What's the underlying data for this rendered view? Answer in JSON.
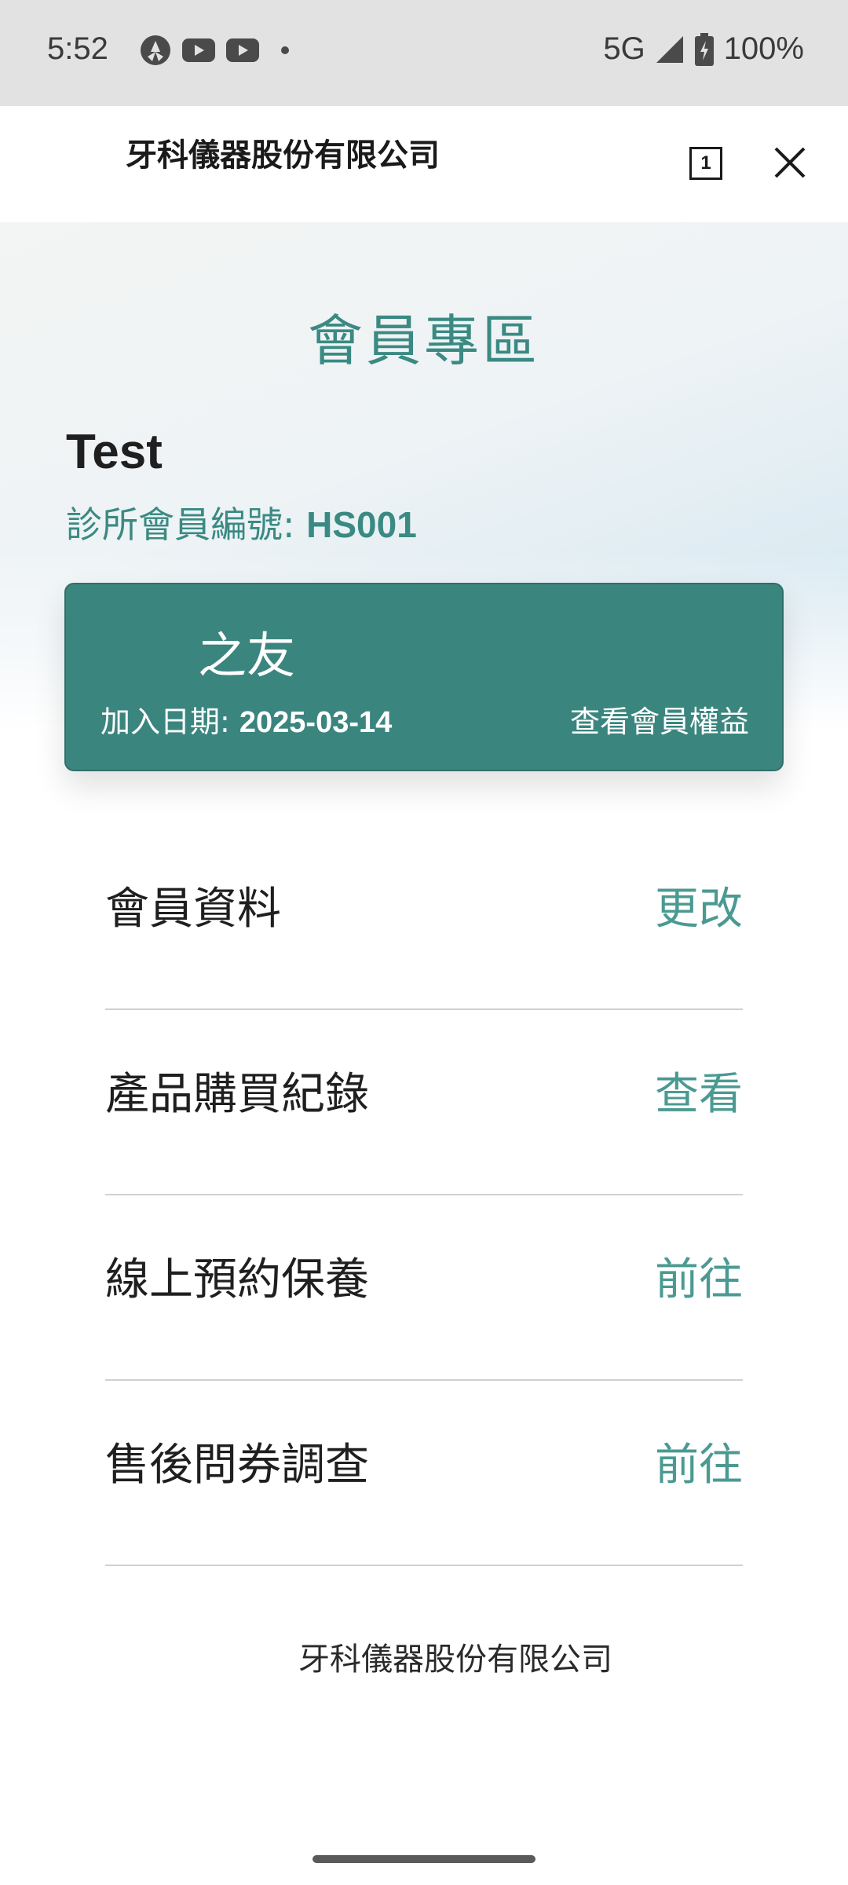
{
  "status_bar": {
    "time": "5:52",
    "network": "5G",
    "battery": "100%",
    "icons": [
      "app-icon",
      "youtube-icon",
      "youtube-icon",
      "notification-dot-icon",
      "signal-icon",
      "battery-charging-icon"
    ]
  },
  "title_bar": {
    "title": "牙科儀器股份有限公司",
    "tab_count": "1"
  },
  "hero": {
    "page_title": "會員專區",
    "user_name": "Test",
    "member_id_label": "診所會員編號: ",
    "member_id_value": "HS001"
  },
  "member_card": {
    "tier_name": "之友",
    "join_date_label": "加入日期: ",
    "join_date_value": "2025-03-14",
    "benefits_link": "查看會員權益"
  },
  "menu": {
    "items": [
      {
        "label": "會員資料",
        "action": "更改"
      },
      {
        "label": "產品購買紀錄",
        "action": "查看"
      },
      {
        "label": "線上預約保養",
        "action": "前往"
      },
      {
        "label": "售後問券調查",
        "action": "前往"
      }
    ]
  },
  "footer": {
    "company": "牙科儀器股份有限公司"
  },
  "colors": {
    "accent": "#3b857f",
    "accent_text": "#4a9a92",
    "title_text": "#3a8a83"
  }
}
